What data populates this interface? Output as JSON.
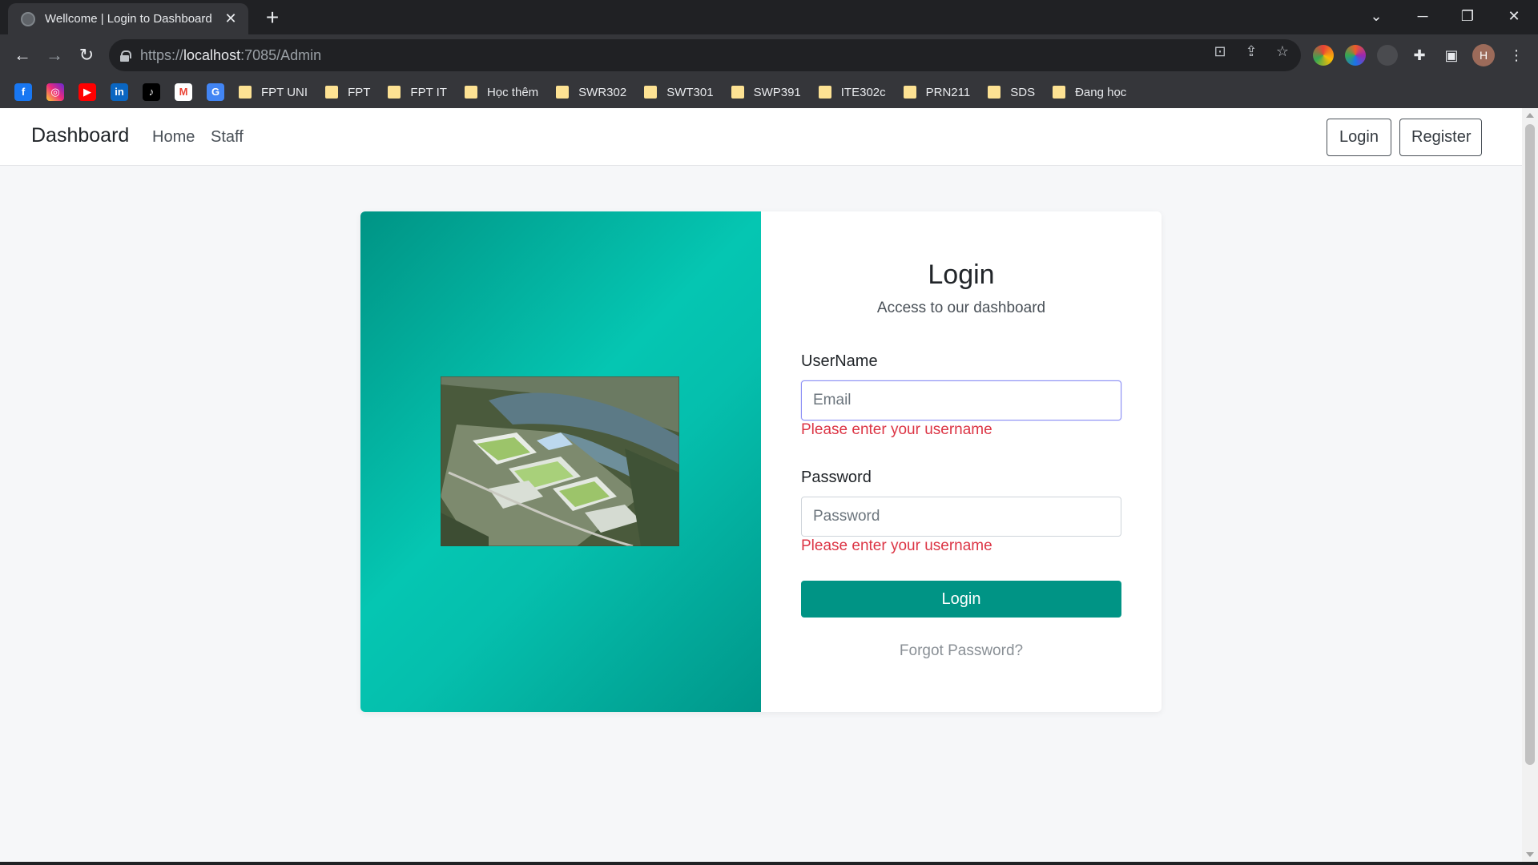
{
  "browser": {
    "tab_title": "Wellcome | Login to Dashboard",
    "tab_close": "✕",
    "new_tab": "+",
    "url_scheme": "https://",
    "url_host": "localhost",
    "url_path": ":7085/Admin",
    "bookmarks": [
      "FPT UNI",
      "FPT",
      "FPT IT",
      "Học thêm",
      "SWR302",
      "SWT301",
      "SWP391",
      "ITE302c",
      "PRN211",
      "SDS",
      "Đang học"
    ],
    "avatar_letter": "H",
    "icons": {
      "back": "back-arrow-icon",
      "forward": "forward-arrow-icon",
      "reload": "reload-icon",
      "translate": "translate-icon",
      "share": "share-icon",
      "star": "star-icon",
      "extensions": "puzzle-icon",
      "menu": "kebab-menu-icon"
    }
  },
  "navbar": {
    "brand": "Dashboard",
    "links": [
      "Home",
      "Staff"
    ],
    "login_button": "Login",
    "register_button": "Register"
  },
  "login": {
    "title": "Login",
    "subtitle": "Access to our dashboard",
    "username_label": "UserName",
    "username_placeholder": "Email",
    "username_error": "Please enter your username",
    "password_label": "Password",
    "password_placeholder": "Password",
    "password_error": "Please enter your username",
    "submit_label": "Login",
    "forgot_link": "Forgot Password?"
  },
  "colors": {
    "accent": "#009485",
    "error": "#dc3545",
    "focus_border": "#8c8ff5"
  }
}
